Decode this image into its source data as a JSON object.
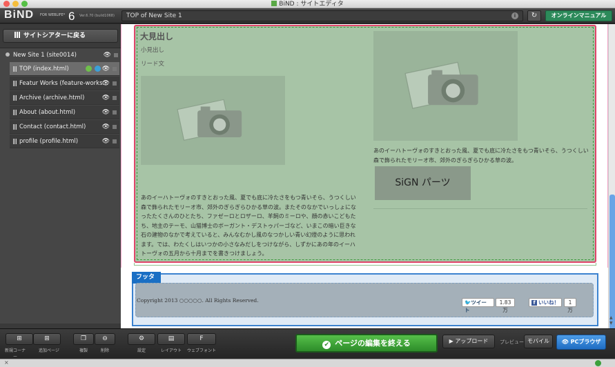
{
  "window": {
    "title": "BiND : サイトエディタ"
  },
  "logo": {
    "name": "BiND",
    "sub": "FOR WEBLIFE*",
    "version": "6",
    "build": "Ver.6.70 (build1068)"
  },
  "topbar": {
    "page_address": "TOP of New Site 1",
    "info": "i",
    "refresh": "↻",
    "manual_label": "オンラインマニュアル"
  },
  "sidebar": {
    "back_label": "サイトシアターに戻る",
    "site": {
      "label": "New Site 1 (site0014)"
    },
    "pages": [
      {
        "label": "TOP (index.html)",
        "selected": true
      },
      {
        "label": "Featur Works (feature-works..."
      },
      {
        "label": "Archive (archive.html)"
      },
      {
        "label": "About (about.html)"
      },
      {
        "label": "Contact (contact.html)"
      },
      {
        "label": "profile (profile.html)"
      }
    ]
  },
  "content": {
    "heading": "大見出し",
    "subheading": "小見出し",
    "lead": "リード文",
    "body_left": "あのイーハトーヴォのすきとおった風、夏でも底に冷たさをもつ青いそら、うつくしい森で飾られたモリーオ市、郊外のぎらぎらひかる草の波。またそのなかでいっしょになったたくさんのひとたち、ファゼーロとロザーロ、羊飼のミーロや、顔の赤いこどもたち、地主のテーモ、山猫博士のボーガント・デストゥパーゴなど、いまこの暗い巨きな石の建物のなかで考えていると、みんなむかし風のなつかしい青い幻燈のように思われます。では、わたくしはいつかの小さなみだしをつけながら、しずかにあの年のイーハトーヴォの五月から十月までを書きつけましょう。",
    "body_right": "あのイーハトーヴォのすきとおった風、夏でも底に冷たさをもつ青いそら、うつくしい森で飾られたモリーオ市、郊外のぎらぎらひかる草の波。",
    "sign_parts": "SiGN パーツ"
  },
  "footer": {
    "tab_label": "フッタ",
    "copyright": "Copyright 2013 ○○○○○. All Rights Reserved.",
    "tweet_label": "ツイート",
    "tweet_count": "1.83万",
    "like_label": "いいね！",
    "like_count": "1万"
  },
  "toolbar": {
    "new_corner_label": "新規コーナー",
    "add_page_label": "追加ページ",
    "duplicate_label": "複製",
    "delete_label": "削除",
    "settings_label": "設定",
    "layout_label": "レイアウト",
    "webfont_label": "ウェブフォント",
    "webfont_glyph": "F",
    "finish_label": "ページの編集を終える",
    "upload_label": "アップロード",
    "preview_label": "プレビュー",
    "mobile_label": "モバイル",
    "pc_browser_label": "PCブラウザ"
  },
  "colors": {
    "finish_green": "#2d8c2a",
    "pc_blue": "#1f6cc2",
    "manual_green": "#2c8a5a",
    "main_block": "#a7c4a6",
    "footer_border": "#3b82cf"
  }
}
